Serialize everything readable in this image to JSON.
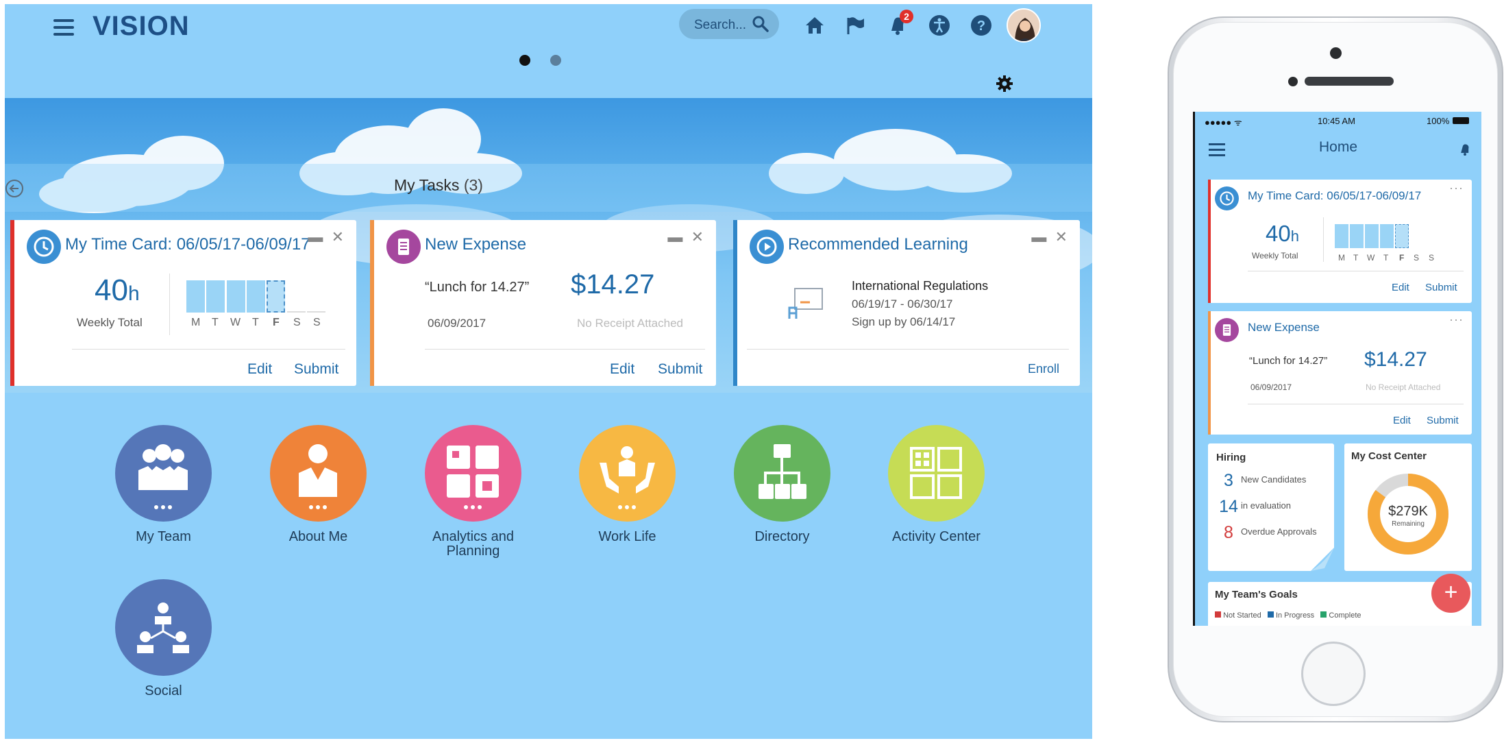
{
  "desktop": {
    "logo": "VISION",
    "search_placeholder": "Search...",
    "notification_count": "2",
    "tasks": {
      "label": "My Tasks",
      "count": "(3)"
    },
    "time_card": {
      "title": "My Time Card: 06/05/17-06/09/17",
      "hours": "40",
      "hours_unit": "h",
      "total_label": "Weekly Total",
      "days": [
        "M",
        "T",
        "W",
        "T",
        "F",
        "S",
        "S"
      ],
      "edit": "Edit",
      "submit": "Submit"
    },
    "expense": {
      "title": "New Expense",
      "description": "“Lunch for 14.27”",
      "amount": "$14.27",
      "date": "06/09/2017",
      "receipt": "No Receipt Attached",
      "edit": "Edit",
      "submit": "Submit"
    },
    "learning": {
      "title": "Recommended Learning",
      "course": "International Regulations",
      "dates": "06/19/17 - 06/30/17",
      "signup": "Sign up by 06/14/17",
      "enroll": "Enroll"
    },
    "launchers": [
      {
        "label": "My Team",
        "color": "#5576b8"
      },
      {
        "label": "About Me",
        "color": "#ef8339"
      },
      {
        "label": "Analytics and Planning",
        "color": "#ea5b8e"
      },
      {
        "label": "Work Life",
        "color": "#f7b843"
      },
      {
        "label": "Directory",
        "color": "#65b45d"
      },
      {
        "label": "Activity Center",
        "color": "#c6dc55"
      },
      {
        "label": "Social",
        "color": "#5576b8"
      }
    ],
    "colors": {
      "background": "#8fd0fa",
      "timecard_accent": "#e0302a",
      "expense_accent": "#f19446",
      "learning_accent": "#2f86c8"
    }
  },
  "phone": {
    "status_time": "10:45 AM",
    "battery": "100%",
    "title": "Home",
    "time_card": {
      "title": "My Time Card: 06/05/17-06/09/17",
      "hours": "40",
      "hours_unit": "h",
      "total_label": "Weekly Total",
      "days": [
        "M",
        "T",
        "W",
        "T",
        "F",
        "S",
        "S"
      ],
      "edit": "Edit",
      "submit": "Submit"
    },
    "expense": {
      "title": "New Expense",
      "description": "“Lunch for 14.27”",
      "amount": "$14.27",
      "date": "06/09/2017",
      "receipt": "No Receipt Attached",
      "edit": "Edit",
      "submit": "Submit"
    },
    "hiring": {
      "title": "Hiring",
      "rows": [
        {
          "value": "3",
          "label": "New Candidates",
          "color": "#1f6aa8"
        },
        {
          "value": "14",
          "label": "in evaluation",
          "color": "#1f6aa8"
        },
        {
          "value": "8",
          "label": "Overdue Approvals",
          "color": "#d23b3b"
        }
      ]
    },
    "cost_center": {
      "title": "My Cost Center",
      "amount": "$279K",
      "sub": "Remaining",
      "fraction": 0.85
    },
    "goals": {
      "title": "My Team's Goals",
      "legend": [
        "Not Started",
        "In Progress",
        "Complete"
      ]
    }
  }
}
